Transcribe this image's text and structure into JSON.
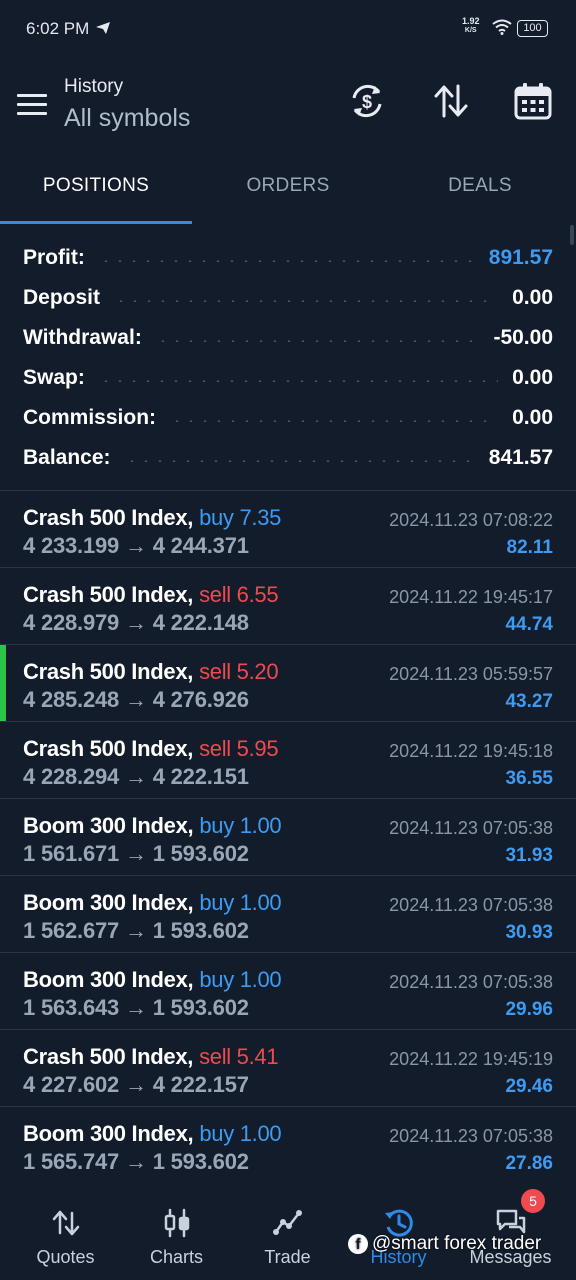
{
  "status_bar": {
    "time": "6:02 PM",
    "speed_value": "1.92",
    "speed_unit": "K/S",
    "battery": "100",
    "icons": [
      "telegram-send-icon",
      "wifi-icon",
      "battery-icon"
    ]
  },
  "header": {
    "title": "History",
    "subtitle": "All symbols",
    "icons": [
      "menu-icon",
      "currency-refresh-icon",
      "sort-icon",
      "calendar-icon"
    ]
  },
  "tabs": [
    {
      "label": "POSITIONS",
      "active": true
    },
    {
      "label": "ORDERS",
      "active": false
    },
    {
      "label": "DEALS",
      "active": false
    }
  ],
  "summary": [
    {
      "label": "Profit:",
      "value": "891.57",
      "accent": true
    },
    {
      "label": "Deposit",
      "value": "0.00",
      "accent": false
    },
    {
      "label": "Withdrawal:",
      "value": "-50.00",
      "accent": false
    },
    {
      "label": "Swap:",
      "value": "0.00",
      "accent": false
    },
    {
      "label": "Commission:",
      "value": "0.00",
      "accent": false
    },
    {
      "label": "Balance:",
      "value": "841.57",
      "accent": false
    }
  ],
  "positions": [
    {
      "symbol": "Crash 500 Index,",
      "side": "buy",
      "side_text": "buy 7.35",
      "prices": "4 233.199 → 4 244.371",
      "time": "2024.11.23 07:08:22",
      "profit": "82.11",
      "marked": false
    },
    {
      "symbol": "Crash 500 Index,",
      "side": "sell",
      "side_text": "sell 6.55",
      "prices": "4 228.979 → 4 222.148",
      "time": "2024.11.22 19:45:17",
      "profit": "44.74",
      "marked": false
    },
    {
      "symbol": "Crash 500 Index,",
      "side": "sell",
      "side_text": "sell 5.20",
      "prices": "4 285.248 → 4 276.926",
      "time": "2024.11.23 05:59:57",
      "profit": "43.27",
      "marked": true
    },
    {
      "symbol": "Crash 500 Index,",
      "side": "sell",
      "side_text": "sell 5.95",
      "prices": "4 228.294 → 4 222.151",
      "time": "2024.11.22 19:45:18",
      "profit": "36.55",
      "marked": false
    },
    {
      "symbol": "Boom 300 Index,",
      "side": "buy",
      "side_text": "buy 1.00",
      "prices": "1 561.671 → 1 593.602",
      "time": "2024.11.23 07:05:38",
      "profit": "31.93",
      "marked": false
    },
    {
      "symbol": "Boom 300 Index,",
      "side": "buy",
      "side_text": "buy 1.00",
      "prices": "1 562.677 → 1 593.602",
      "time": "2024.11.23 07:05:38",
      "profit": "30.93",
      "marked": false
    },
    {
      "symbol": "Boom 300 Index,",
      "side": "buy",
      "side_text": "buy 1.00",
      "prices": "1 563.643 → 1 593.602",
      "time": "2024.11.23 07:05:38",
      "profit": "29.96",
      "marked": false
    },
    {
      "symbol": "Crash 500 Index,",
      "side": "sell",
      "side_text": "sell 5.41",
      "prices": "4 227.602 → 4 222.157",
      "time": "2024.11.22 19:45:19",
      "profit": "29.46",
      "marked": false
    },
    {
      "symbol": "Boom 300 Index,",
      "side": "buy",
      "side_text": "buy 1.00",
      "prices": "1 565.747 → 1 593.602",
      "time": "2024.11.23 07:05:38",
      "profit": "27.86",
      "marked": false
    }
  ],
  "bottom_nav": [
    {
      "label": "Quotes",
      "icon": "quotes-icon",
      "active": false
    },
    {
      "label": "Charts",
      "icon": "charts-icon",
      "active": false
    },
    {
      "label": "Trade",
      "icon": "trade-icon",
      "active": false
    },
    {
      "label": "History",
      "icon": "history-icon",
      "active": true
    },
    {
      "label": "Messages",
      "icon": "messages-icon",
      "active": false,
      "badge": "5"
    }
  ],
  "watermark": {
    "text": "@smart forex trader"
  },
  "colors": {
    "background": "#131c2b",
    "accent_blue": "#3d9bf2",
    "sell_red": "#ef4a4f",
    "marker_green": "#2dc44a"
  }
}
